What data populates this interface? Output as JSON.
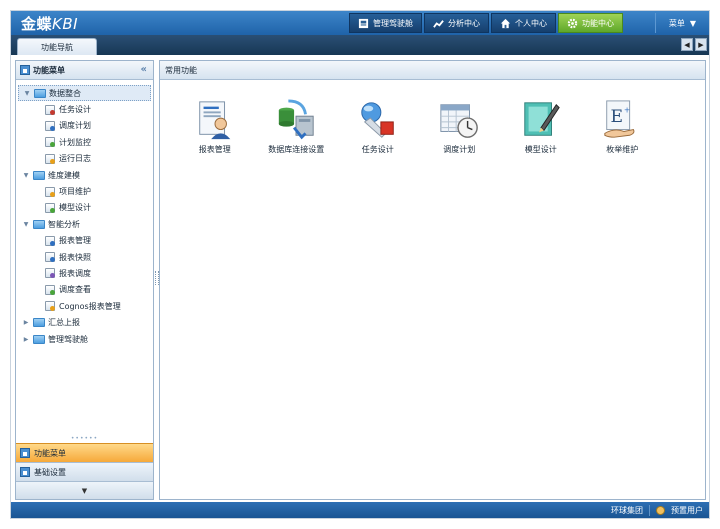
{
  "app": {
    "logo_text": "金蝶",
    "logo_brand": "KBI"
  },
  "topnav": [
    {
      "label": "管理驾驶舱",
      "icon": "dashboard-icon"
    },
    {
      "label": "分析中心",
      "icon": "trend-icon"
    },
    {
      "label": "个人中心",
      "icon": "home-icon"
    },
    {
      "label": "功能中心",
      "icon": "gear-icon",
      "active": true
    }
  ],
  "menu": {
    "label": "菜单"
  },
  "tabs": [
    {
      "label": "功能导航"
    }
  ],
  "sidebar": {
    "title": "功能菜单",
    "tree": [
      {
        "label": "数据整合",
        "icon": "folder-icon",
        "expanded": true,
        "selected": true,
        "children": [
          "任务设计",
          "调度计划",
          "计划监控",
          "运行日志"
        ]
      },
      {
        "label": "维度建模",
        "icon": "folder-icon",
        "expanded": true,
        "children": [
          "项目维护",
          "模型设计"
        ]
      },
      {
        "label": "智能分析",
        "icon": "folder-icon",
        "expanded": true,
        "children": [
          "报表管理",
          "报表快照",
          "报表调度",
          "调度查看",
          "Cognos报表管理"
        ]
      },
      {
        "label": "汇总上报",
        "icon": "folder-icon",
        "expanded": false,
        "children": []
      },
      {
        "label": "管理驾驶舱",
        "icon": "folder-icon",
        "expanded": false,
        "children": []
      }
    ],
    "accordion": [
      {
        "label": "功能菜单",
        "active": true
      },
      {
        "label": "基础设置",
        "active": false
      }
    ]
  },
  "main": {
    "title": "常用功能",
    "functions": [
      {
        "label": "报表管理",
        "icon": "report-user-icon"
      },
      {
        "label": "数据库连接设置",
        "icon": "database-connection-icon"
      },
      {
        "label": "任务设计",
        "icon": "task-design-icon"
      },
      {
        "label": "调度计划",
        "icon": "schedule-clock-icon"
      },
      {
        "label": "模型设计",
        "icon": "model-pen-icon"
      },
      {
        "label": "枚举维护",
        "icon": "enum-hand-icon"
      }
    ]
  },
  "footer": {
    "org": "环球集团",
    "user": "预置用户"
  },
  "colors": {
    "topbar": "#2a70b8",
    "active_nav": "#7cc13e",
    "accordion_active": "#f6b24a",
    "panel_border": "#9db4cc"
  }
}
